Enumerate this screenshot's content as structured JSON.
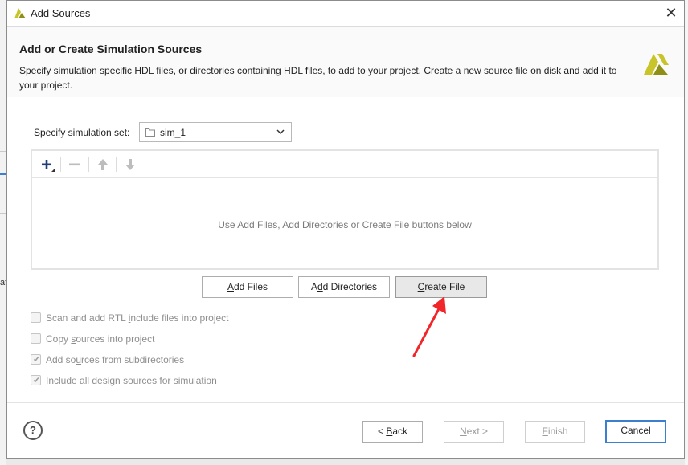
{
  "window": {
    "title": "Add Sources",
    "close_glyph": "✕",
    "logo_icon": "vivado-logo-icon"
  },
  "header": {
    "title": "Add or Create Simulation Sources",
    "description": "Specify simulation specific HDL files, or directories containing HDL files, to add to your project. Create a new source file on disk and add it to your project."
  },
  "simulation_set": {
    "label": "Specify simulation set:",
    "value": "sim_1",
    "icon": "folder-icon"
  },
  "files_panel": {
    "toolbar": [
      "add-icon",
      "remove-icon",
      "move-up-icon",
      "move-down-icon"
    ],
    "empty_text": "Use Add Files, Add Directories or Create File buttons below"
  },
  "actions": {
    "add_files": {
      "prefix": "",
      "mnemonic": "A",
      "rest": "dd Files"
    },
    "add_directories": {
      "prefix": "A",
      "mnemonic": "d",
      "rest": "d Directories"
    },
    "create_file": {
      "prefix": "",
      "mnemonic": "C",
      "rest": "reate File"
    }
  },
  "options": [
    {
      "prefix": "Scan and add RTL ",
      "mnemonic": "i",
      "rest": "nclude files into project",
      "checked": false
    },
    {
      "prefix": "Copy ",
      "mnemonic": "s",
      "rest": "ources into project",
      "checked": false
    },
    {
      "prefix": "Add so",
      "mnemonic": "u",
      "rest": "rces from subdirectories",
      "checked": true
    },
    {
      "prefix": "Include all design sources for simulation",
      "mnemonic": "",
      "rest": "",
      "checked": true
    }
  ],
  "footer": {
    "help_label": "?",
    "back": {
      "prefix": "< ",
      "mnemonic": "B",
      "rest": "ack"
    },
    "next": {
      "prefix": "",
      "mnemonic": "N",
      "rest": "ext >"
    },
    "finish": {
      "prefix": "",
      "mnemonic": "F",
      "rest": "inish"
    },
    "cancel": "Cancel"
  },
  "background": {
    "left_fragment_text": "at"
  },
  "colors": {
    "accent_blue": "#3c7fcf",
    "logo_yellow": "#c8c42a",
    "logo_olive": "#8f8f18",
    "annotation_red": "#f0262a",
    "disabled_text": "#8e8e8e"
  }
}
